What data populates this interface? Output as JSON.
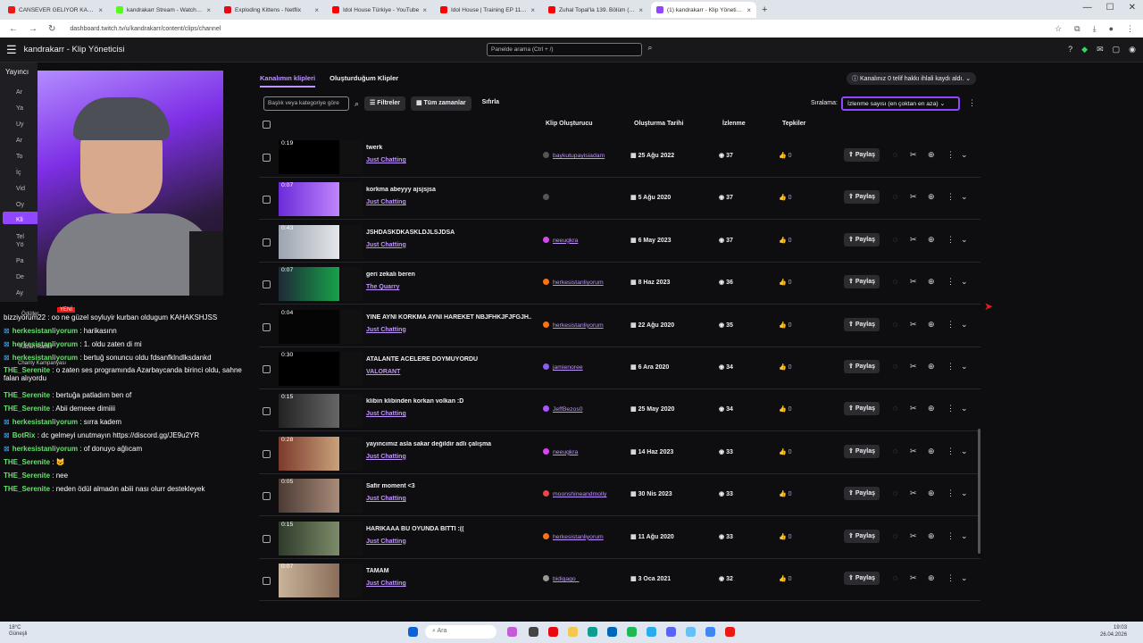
{
  "browser": {
    "tabs": [
      {
        "label": "CANSEVER GELİYOR KAHK",
        "color": "#e91916",
        "active": false
      },
      {
        "label": "kandrakarr Stream - Watch Live",
        "color": "#53fc18",
        "active": false
      },
      {
        "label": "Exploding Kittens - Netflix",
        "color": "#e50914",
        "active": false
      },
      {
        "label": "Idol House Türkiye - YouTube",
        "color": "#ff0000",
        "active": false
      },
      {
        "label": "Idol House | Training EP 11 | Awa",
        "color": "#ff0000",
        "active": false
      },
      {
        "label": "Zuhal Topal'la 139. Bölüm (HD)",
        "color": "#ff0000",
        "active": false
      },
      {
        "label": "(1) kandrakarr - Klip Yöneticisi",
        "color": "#9147ff",
        "active": true
      }
    ],
    "url": "dashboard.twitch.tv/u/kandrakarr/content/clips/channel"
  },
  "header": {
    "title": "kandrakarr - Klip Yöneticisi",
    "search_placeholder": "Panelde arama (Ctrl + /)",
    "notification_count": "1"
  },
  "sidebar": {
    "heading": "Yayıncı",
    "items": [
      "Ar",
      "Ya",
      "Uy",
      "Ar",
      "To",
      "İç",
      "Vid",
      "Oy",
      "Kli",
      "Tel",
      "Yö",
      "Pa",
      "De",
      "Ay"
    ]
  },
  "chat": {
    "overlay_labels": [
      "YENİ",
      "Ödüller",
      "Kazan Atabilir",
      "Charity Kampanyası"
    ],
    "lines": [
      {
        "user": "",
        "text": "bizziyorum22 : ",
        "msg": "oo ne güzel soyluyir kurban oldugum KAHAKSHJSS"
      },
      {
        "user": "herkesistanliyorum",
        "text": "",
        "msg": ": harikasınn"
      },
      {
        "user": "herkesistanliyorum",
        "text": "",
        "msg": ": 1. oldu zaten di mi"
      },
      {
        "user": "herkesistanliyorum",
        "text": "",
        "msg": ": bertuğ sonuncu oldu fdsanfklndlksdankd"
      },
      {
        "user": "THE_Serenite",
        "text": "",
        "msg": ": o zaten ses programında Azarbaycanda birinci oldu, sahne falan alıyordu"
      },
      {
        "user": "THE_Serenite",
        "text": "",
        "msg": ": bertuğa patladım ben of"
      },
      {
        "user": "THE_Serenite",
        "text": "",
        "msg": ": Abii demeee dimiiii"
      },
      {
        "user": "herkesistanliyorum",
        "text": "",
        "msg": ": sırra kadem"
      },
      {
        "user": "BotRix",
        "text": "",
        "msg": ": dc gelmeyi unutmayın https://discord.gg/JE9u2YR"
      },
      {
        "user": "herkesistanliyorum",
        "text": "",
        "msg": ": of donuyo ağlıcam"
      },
      {
        "user": "THE_Serenite",
        "text": "",
        "msg": ": 😺"
      },
      {
        "user": "THE_Serenite",
        "text": "",
        "msg": ": nee"
      },
      {
        "user": "THE_Serenite",
        "text": "",
        "msg": ": neden ödül almadın abiii nası olurr destekleyek"
      }
    ]
  },
  "clips": {
    "tabs": [
      "Kanalımın klipleri",
      "Oluşturduğum Klipler"
    ],
    "copyright_notice": "Kanalınız 0 telif hakkı ihlali kaydı aldı.",
    "filter_placeholder": "Başlık veya kategoriye göre",
    "filters_label": "Filtreler",
    "time_label": "Tüm zamanlar",
    "reset_label": "Sıfırla",
    "sort_label": "Sıralama:",
    "sort_value": "İzlenme sayısı (en çoktan en aza)",
    "columns": [
      "Klip Oluşturucu",
      "Oluşturma Tarihi",
      "İzlenme",
      "Tepkiler"
    ],
    "share_label": "Paylaş",
    "rows": [
      {
        "duration": "0:19",
        "title": "twerk",
        "category": "Just Chatting",
        "creator": "baykutupayisiadam",
        "date": "25 Ağu 2022",
        "views": "37",
        "likes": "0",
        "av": "#555"
      },
      {
        "duration": "0:07",
        "title": "korkma abeyyy ajsjsjsa",
        "category": "Just Chatting",
        "creator": "",
        "date": "5 Ağu 2020",
        "views": "37",
        "likes": "0",
        "av": "#555"
      },
      {
        "duration": "0:43",
        "title": "JSHDASKDKASKLDJLSJDSA",
        "category": "Just Chatting",
        "creator": "neeugkra",
        "date": "6 May 2023",
        "views": "37",
        "likes": "0",
        "av": "#d946ef"
      },
      {
        "duration": "0:07",
        "title": "geri zekalı beren",
        "category": "The Quarry",
        "creator": "herkesistanliyorum",
        "date": "8 Haz 2023",
        "views": "36",
        "likes": "0",
        "av": "#f97316"
      },
      {
        "duration": "0:04",
        "title": "YİNE AYNI KORKMA AYNI HAREKET NBJFHKJFJFGJH...",
        "category": "Just Chatting",
        "creator": "herkesistanliyorum",
        "date": "22 Ağu 2020",
        "views": "35",
        "likes": "0",
        "av": "#f97316"
      },
      {
        "duration": "0:30",
        "title": "ATALANTE ACELERE DOYMUYORDU",
        "category": "VALORANT",
        "creator": "jamienoree",
        "date": "6 Ara 2020",
        "views": "34",
        "likes": "0",
        "av": "#8b5cf6"
      },
      {
        "duration": "0:15",
        "title": "klibin klibinden korkan volkan :D",
        "category": "Just Chatting",
        "creator": "JeffBezos0",
        "date": "25 May 2020",
        "views": "34",
        "likes": "0",
        "av": "#a855f7"
      },
      {
        "duration": "0:28",
        "title": "yayıncımız asla sakar değildir adlı çalışma",
        "category": "Just Chatting",
        "creator": "neeugkra",
        "date": "14 Haz 2023",
        "views": "33",
        "likes": "0",
        "av": "#d946ef"
      },
      {
        "duration": "0:05",
        "title": "Safir moment <3",
        "category": "Just Chatting",
        "creator": "moonshineandmolly",
        "date": "30 Nis 2023",
        "views": "33",
        "likes": "0",
        "av": "#ef4444"
      },
      {
        "duration": "0:15",
        "title": "HARİKAAA BU OYUNDA BİTTİ :((",
        "category": "Just Chatting",
        "creator": "herkesistanliyorum",
        "date": "11 Ağu 2020",
        "views": "33",
        "likes": "0",
        "av": "#f97316"
      },
      {
        "duration": "0:07",
        "title": "TAMAM",
        "category": "Just Chatting",
        "creator": "bidigago_",
        "date": "3 Oca 2021",
        "views": "32",
        "likes": "0",
        "av": "#999"
      }
    ]
  },
  "taskbar": {
    "weather_temp": "18°C",
    "weather_desc": "Güneşli",
    "search_placeholder": "Ara",
    "time": "19:03",
    "date": "26.04.2026"
  }
}
